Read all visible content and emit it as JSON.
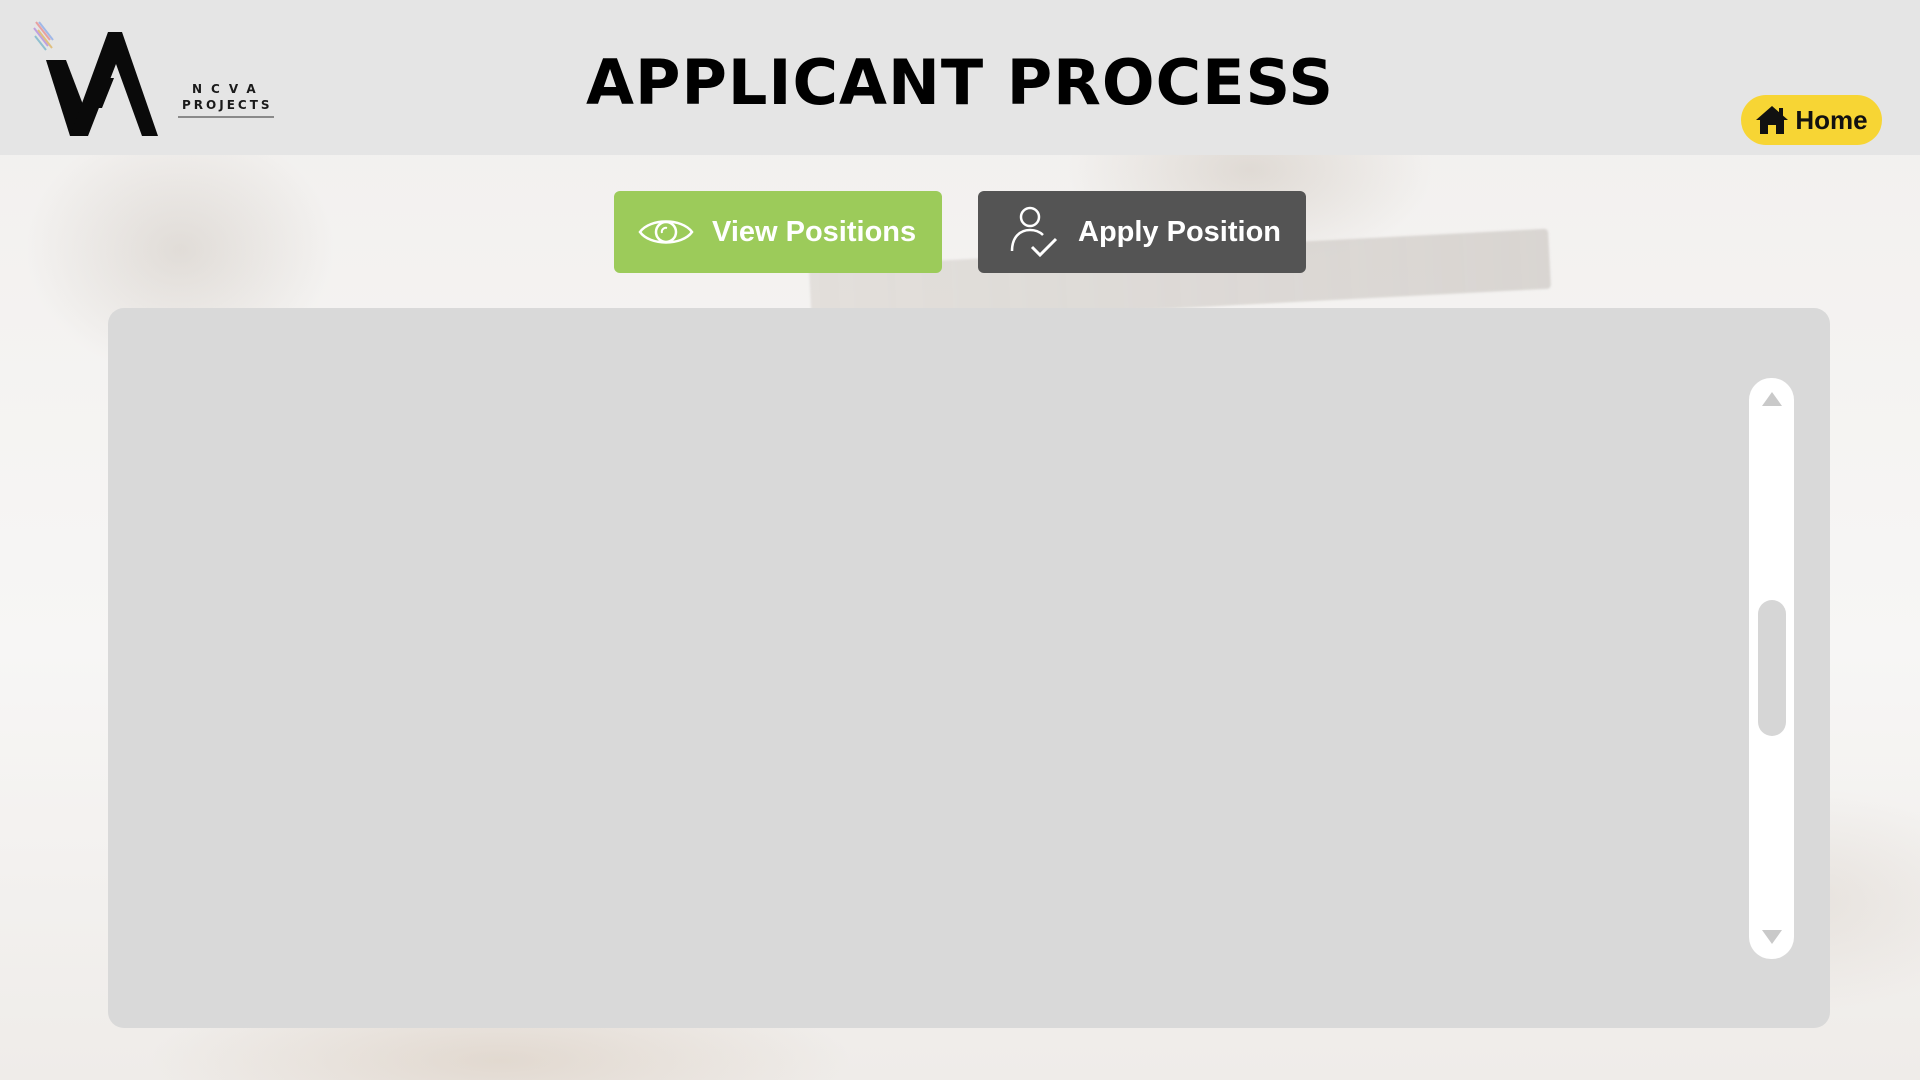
{
  "header": {
    "title": "APPLICANT PROCESS",
    "logo": {
      "line1": "NCVA",
      "line2": "PROJECTS",
      "mark_icon": "va-logo-mark"
    },
    "home_button": {
      "label": "Home",
      "icon": "home-icon",
      "color": "#f7d534"
    },
    "background_color": "#e5e5e5"
  },
  "actions": {
    "view_positions": {
      "label": "View Positions",
      "icon": "eye-icon",
      "color": "#9ccb5a"
    },
    "apply_position": {
      "label": "Apply Position",
      "icon": "user-check-icon",
      "color": "#545454"
    }
  },
  "content_panel": {
    "background_color": "#d9d9d9",
    "scrollbar": {
      "up_icon": "scroll-up-arrow-icon",
      "down_icon": "scroll-down-arrow-icon"
    }
  }
}
